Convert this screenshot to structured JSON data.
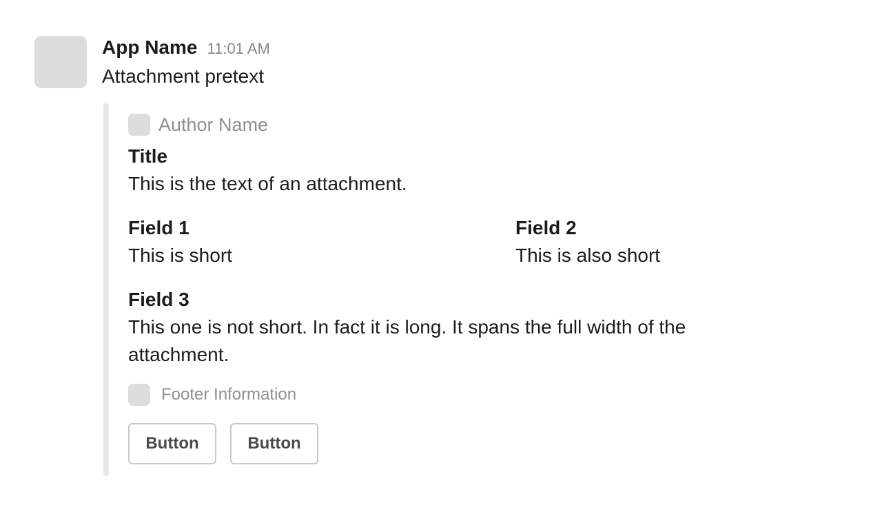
{
  "message": {
    "app_name": "App Name",
    "timestamp": "11:01 AM",
    "pretext": "Attachment pretext"
  },
  "attachment": {
    "author_name": "Author Name",
    "title": "Title",
    "text": "This is the text of an attachment.",
    "fields": [
      {
        "title": "Field 1",
        "value": "This is short"
      },
      {
        "title": "Field 2",
        "value": "This is also short"
      },
      {
        "title": "Field 3",
        "value": "This one is not short. In fact it is long. It spans the full width of the attachment."
      }
    ],
    "footer": "Footer Information",
    "buttons": [
      {
        "label": "Button"
      },
      {
        "label": "Button"
      }
    ],
    "bar_color": "#e8e8e8"
  }
}
